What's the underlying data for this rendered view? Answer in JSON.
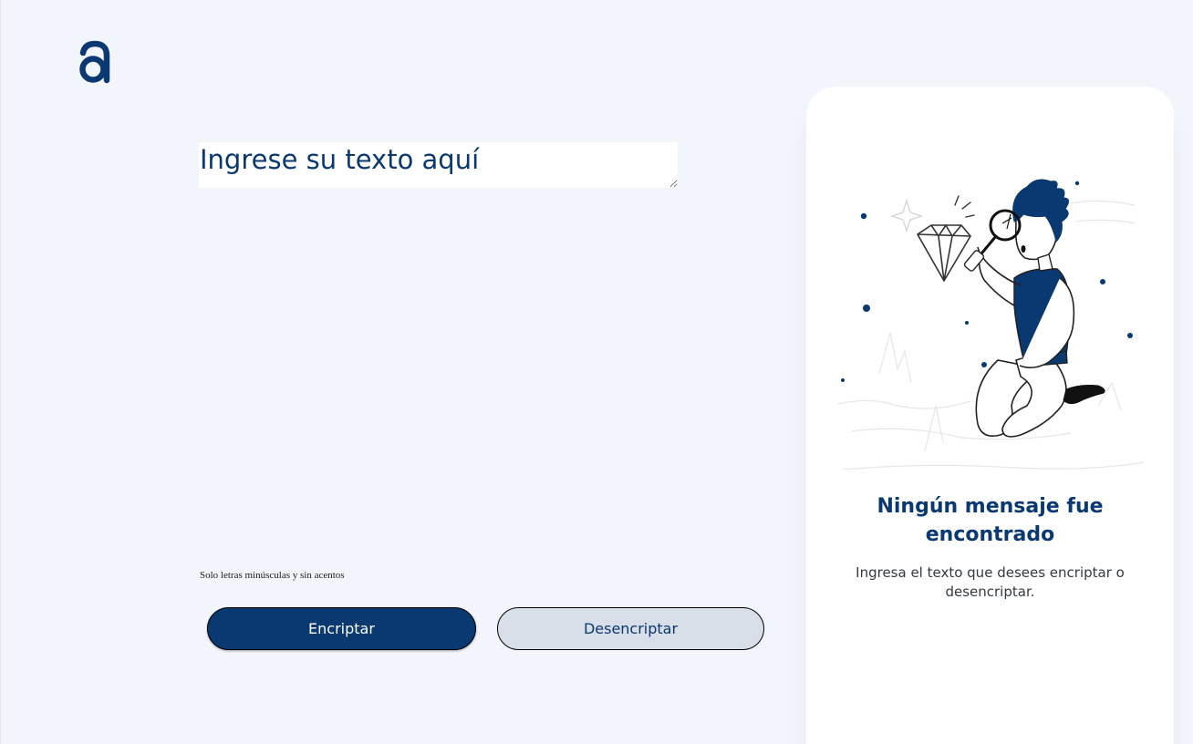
{
  "brand": {
    "logo_letter": "a",
    "accent_color": "#0a3871"
  },
  "input": {
    "placeholder": "Ingrese su texto aquí",
    "value": ""
  },
  "hint": {
    "text": "Solo letras minúsculas y sin acentos"
  },
  "buttons": {
    "encrypt_label": "Encriptar",
    "decrypt_label": "Desencriptar"
  },
  "result": {
    "title": "Ningún mensaje fue encontrado",
    "message": "Ingresa el texto que desees encriptar o desencriptar.",
    "illustration_icon": "person-with-magnifying-glass-and-diamond"
  }
}
